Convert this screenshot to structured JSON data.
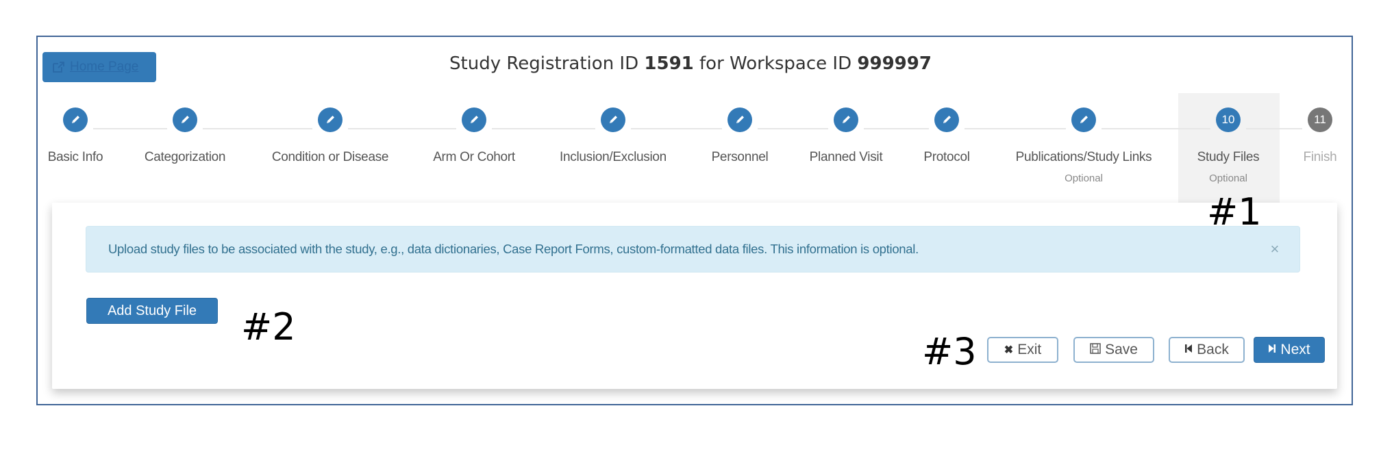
{
  "header": {
    "home_button_label": "Home Page",
    "home_icon": "external-link-icon",
    "title_prefix": "Study Registration ID",
    "study_id": "1591",
    "title_middle": "for Workspace ID",
    "workspace_id": "999997"
  },
  "wizard": {
    "steps": [
      {
        "label": "Basic Info",
        "state": "completed",
        "icon": "pencil-icon"
      },
      {
        "label": "Categorization",
        "state": "completed",
        "icon": "pencil-icon"
      },
      {
        "label": "Condition or Disease",
        "state": "completed",
        "icon": "pencil-icon"
      },
      {
        "label": "Arm Or Cohort",
        "state": "completed",
        "icon": "pencil-icon"
      },
      {
        "label": "Inclusion/Exclusion",
        "state": "completed",
        "icon": "pencil-icon"
      },
      {
        "label": "Personnel",
        "state": "completed",
        "icon": "pencil-icon"
      },
      {
        "label": "Planned Visit",
        "state": "completed",
        "icon": "pencil-icon"
      },
      {
        "label": "Protocol",
        "state": "completed",
        "icon": "pencil-icon"
      },
      {
        "label": "Publications/Study Links",
        "state": "completed",
        "icon": "pencil-icon",
        "sub": "Optional"
      },
      {
        "label": "Study Files",
        "state": "active",
        "number": "10",
        "sub": "Optional"
      },
      {
        "label": "Finish",
        "state": "upcoming",
        "number": "11"
      }
    ]
  },
  "alert": {
    "text": "Upload study files to be associated with the study, e.g., data dictionaries, Case Report Forms, custom-formatted data files. This information is optional.",
    "close_symbol": "×"
  },
  "actions": {
    "add_study_file": "Add Study File",
    "exit": "Exit",
    "save": "Save",
    "back": "Back",
    "next": "Next"
  },
  "annotations": {
    "a1": "#1",
    "a2": "#2",
    "a3": "#3"
  },
  "colors": {
    "primary": "#337ab7",
    "alert_bg": "#d9edf7",
    "upcoming_step": "#777777",
    "frame_border": "#3f6496"
  }
}
